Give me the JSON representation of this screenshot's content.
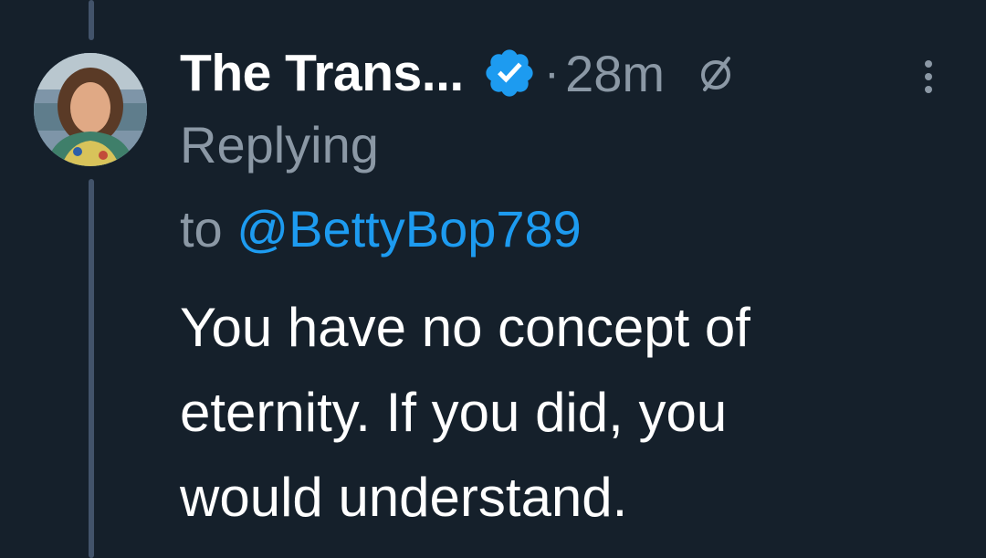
{
  "colors": {
    "background": "#15202b",
    "secondary_text": "#8b98a5",
    "link": "#1d9bf0",
    "verified": "#1d9bf0",
    "thread_line": "#42536a"
  },
  "tweet": {
    "author": {
      "display_name": "The Trans...",
      "verified_icon": "verified-badge-icon",
      "avatar": "avatar"
    },
    "separator": "·",
    "timestamp": "28m",
    "edit_icon": "edit-history-icon",
    "more_icon": "more-options-icon",
    "reply_context": {
      "prefix": "Replying",
      "to_word": "to",
      "mention": "@BettyBop789"
    },
    "text_lines": [
      "You have no concept of",
      "eternity. If you did, you",
      "would understand."
    ]
  }
}
